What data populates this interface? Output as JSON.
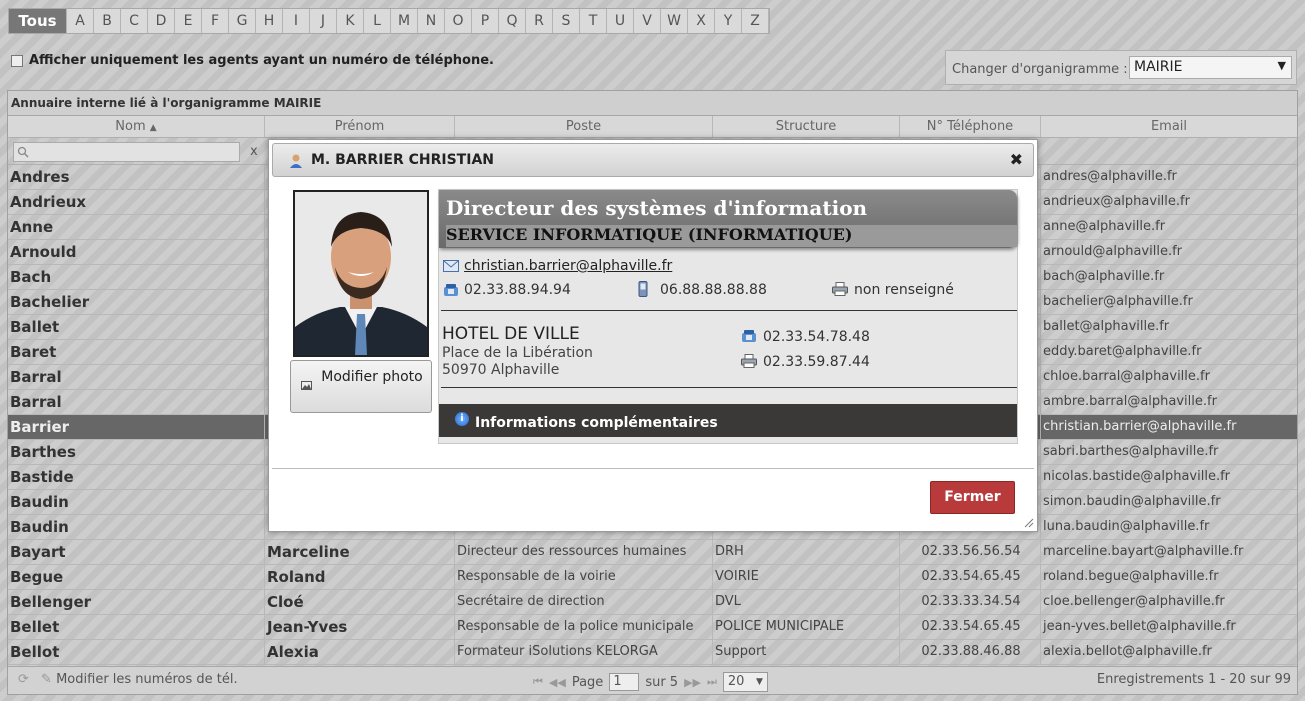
{
  "alphabet": [
    "Tous",
    "A",
    "B",
    "C",
    "D",
    "E",
    "F",
    "G",
    "H",
    "I",
    "J",
    "K",
    "L",
    "M",
    "N",
    "O",
    "P",
    "Q",
    "R",
    "S",
    "T",
    "U",
    "V",
    "W",
    "X",
    "Y",
    "Z"
  ],
  "filter_label": "Afficher uniquement les agents ayant un numéro de téléphone.",
  "org": {
    "label": "Changer d'organigramme :",
    "value": "MAIRIE"
  },
  "grid": {
    "caption": "Annuaire interne lié à l'organigramme MAIRIE",
    "columns": [
      "Nom",
      "Prénom",
      "Poste",
      "Structure",
      "N° Téléphone",
      "Email"
    ],
    "search_clear": "x",
    "rows": [
      [
        "Andres",
        "",
        "",
        "",
        "",
        "andres@alphaville.fr"
      ],
      [
        "Andrieux",
        "",
        "",
        "",
        "",
        "andrieux@alphaville.fr"
      ],
      [
        "Anne",
        "",
        "",
        "",
        "",
        "anne@alphaville.fr"
      ],
      [
        "Arnould",
        "",
        "",
        "",
        "",
        "arnould@alphaville.fr"
      ],
      [
        "Bach",
        "",
        "",
        "",
        "",
        "bach@alphaville.fr"
      ],
      [
        "Bachelier",
        "",
        "",
        "",
        "",
        "bachelier@alphaville.fr"
      ],
      [
        "Ballet",
        "",
        "",
        "",
        "",
        "ballet@alphaville.fr"
      ],
      [
        "Baret",
        "",
        "",
        "",
        "",
        "eddy.baret@alphaville.fr"
      ],
      [
        "Barral",
        "",
        "",
        "",
        "",
        "chloe.barral@alphaville.fr"
      ],
      [
        "Barral",
        "",
        "",
        "",
        "",
        "ambre.barral@alphaville.fr"
      ],
      [
        "Barrier",
        "",
        "",
        "",
        "",
        "christian.barrier@alphaville.fr"
      ],
      [
        "Barthes",
        "",
        "",
        "",
        "",
        "sabri.barthes@alphaville.fr"
      ],
      [
        "Bastide",
        "",
        "",
        "",
        "",
        "nicolas.bastide@alphaville.fr"
      ],
      [
        "Baudin",
        "",
        "",
        "",
        "",
        "simon.baudin@alphaville.fr"
      ],
      [
        "Baudin",
        "",
        "",
        "",
        "",
        "luna.baudin@alphaville.fr"
      ],
      [
        "Bayart",
        "Marceline",
        "Directeur des ressources humaines",
        "DRH",
        "02.33.56.56.54",
        "marceline.bayart@alphaville.fr"
      ],
      [
        "Begue",
        "Roland",
        "Responsable de la voirie",
        "VOIRIE",
        "02.33.54.65.45",
        "roland.begue@alphaville.fr"
      ],
      [
        "Bellenger",
        "Cloé",
        "Secrétaire de direction",
        "DVL",
        "02.33.33.34.54",
        "cloe.bellenger@alphaville.fr"
      ],
      [
        "Bellet",
        "Jean-Yves",
        "Responsable de la police municipale",
        "POLICE MUNICIPALE",
        "02.33.54.65.45",
        "jean-yves.bellet@alphaville.fr"
      ],
      [
        "Bellot",
        "Alexia",
        "Formateur iSolutions KELORGA",
        "Support",
        "02.33.88.46.88",
        "alexia.bellot@alphaville.fr"
      ]
    ]
  },
  "pager": {
    "edit_label": "Modifier les numéros de tél.",
    "page_label": "Page",
    "page_value": "1",
    "of_label": "sur 5",
    "per_page": "20",
    "records": "Enregistrements 1 - 20 sur 99"
  },
  "modal": {
    "title": "M. BARRIER CHRISTIAN",
    "close": "✖",
    "modify_photo": "Modifier photo",
    "job": "Directeur des systèmes d'information",
    "service": "SERVICE INFORMATIQUE (INFORMATIQUE)",
    "email": "christian.barrier@alphaville.fr",
    "phone": "02.33.88.94.94",
    "mobile": "06.88.88.88.88",
    "fax": "non renseigné",
    "site_name": "HOTEL DE VILLE",
    "site_street": "Place de la Libération",
    "site_city": "50970 Alphaville",
    "site_phone": "02.33.54.78.48",
    "site_fax": "02.33.59.87.44",
    "more_info": "Informations complémentaires",
    "close_button": "Fermer"
  }
}
